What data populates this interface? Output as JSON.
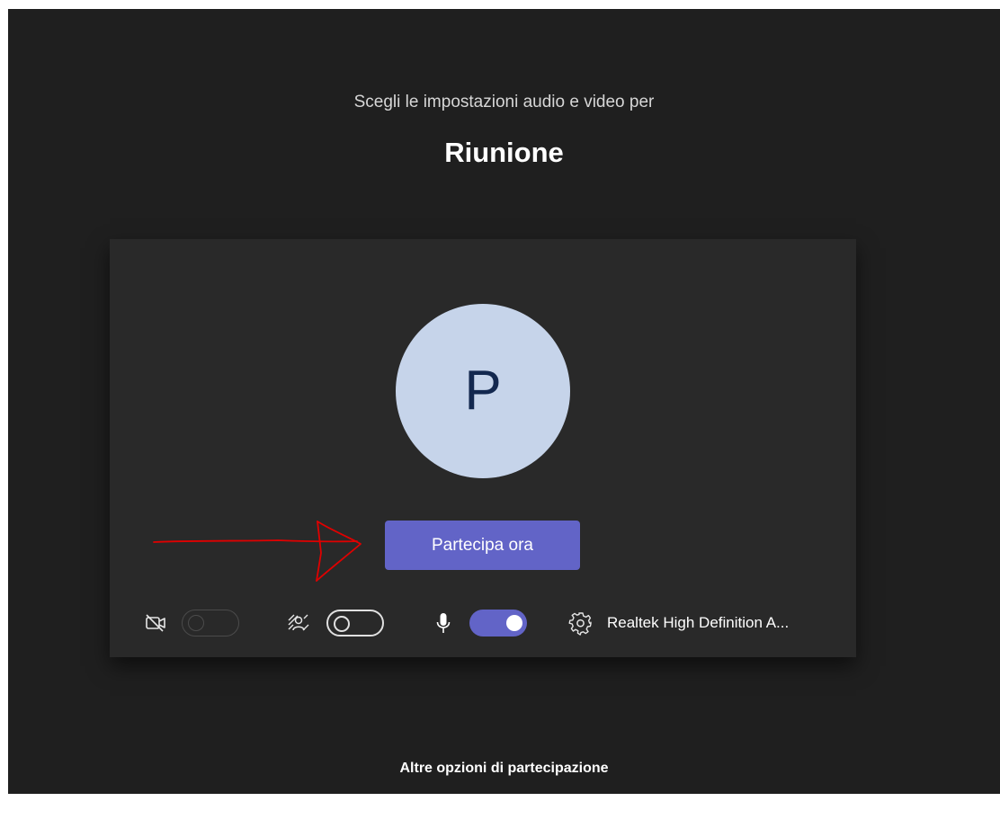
{
  "header": {
    "subtitle": "Scegli le impostazioni audio e video per",
    "meeting_title": "Riunione"
  },
  "preview": {
    "avatar_initial": "P",
    "avatar_bg_color": "#c6d4ea",
    "avatar_text_color": "#13284f",
    "join_button_label": "Partecipa ora",
    "accent_color": "#6264c7"
  },
  "controls": {
    "camera": {
      "icon": "camera-off-icon",
      "state": "off",
      "enabled": false
    },
    "background_effects": {
      "icon": "background-effects-icon",
      "state": "off",
      "enabled": true
    },
    "microphone": {
      "icon": "microphone-icon",
      "state": "on",
      "enabled": true
    },
    "device_settings": {
      "icon": "gear-icon",
      "label": "Realtek High Definition A..."
    }
  },
  "footer": {
    "more_options_label": "Altre opzioni di partecipazione"
  },
  "annotation": {
    "type": "hand-drawn-arrow",
    "color": "#e00000"
  }
}
